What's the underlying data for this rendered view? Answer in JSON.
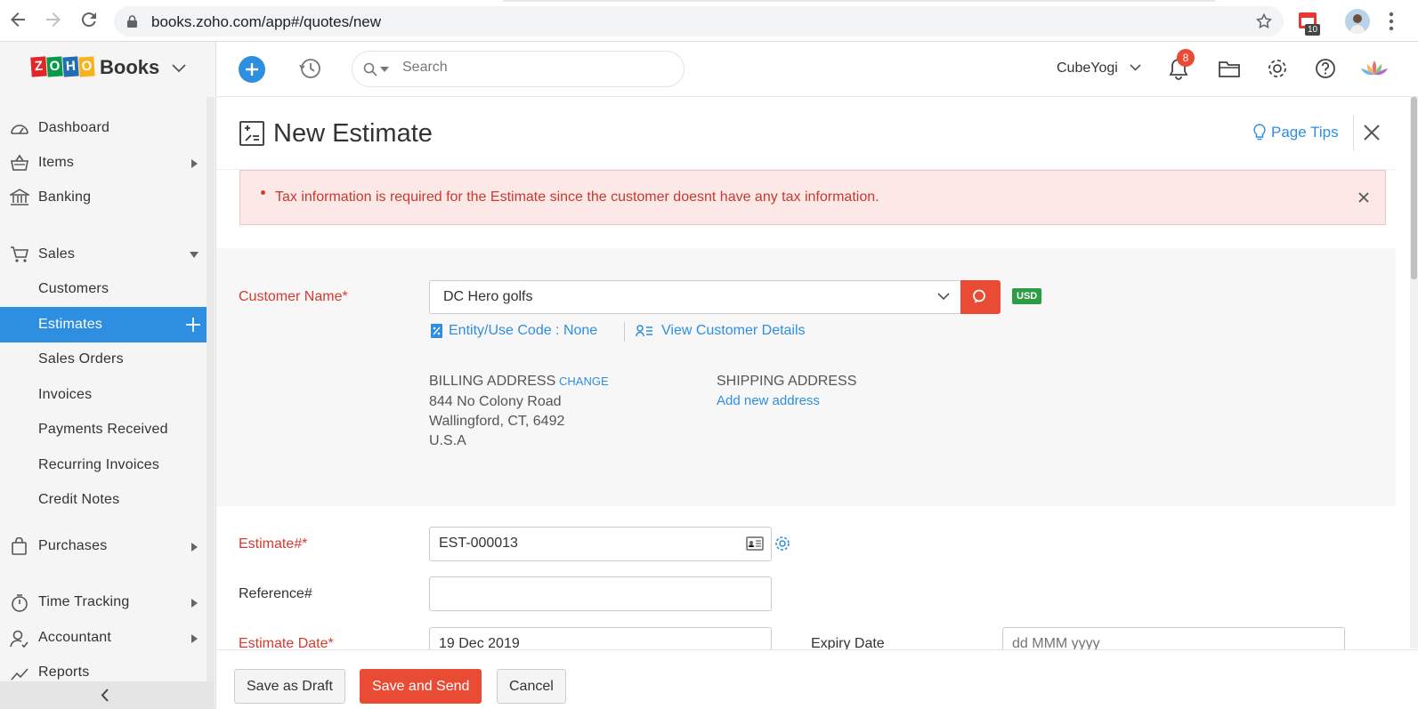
{
  "browser": {
    "url": "books.zoho.com/app#/quotes/new",
    "extension_badge": "10"
  },
  "header": {
    "logo_letters": [
      "Z",
      "O",
      "H",
      "O"
    ],
    "logo_colors": [
      "#e42527",
      "#089949",
      "#226db4",
      "#f9b21d"
    ],
    "product": "Books",
    "search_placeholder": "Search",
    "org_name": "CubeYogi",
    "notification_count": "8"
  },
  "sidebar": {
    "items": [
      {
        "label": "Dashboard",
        "icon": "dashboard-icon"
      },
      {
        "label": "Items",
        "icon": "basket-icon",
        "arrow": "right"
      },
      {
        "label": "Banking",
        "icon": "bank-icon"
      },
      {
        "label": "Sales",
        "icon": "cart-icon",
        "arrow": "down"
      },
      {
        "label": "Customers"
      },
      {
        "label": "Estimates",
        "active": true
      },
      {
        "label": "Sales Orders"
      },
      {
        "label": "Invoices"
      },
      {
        "label": "Payments Received"
      },
      {
        "label": "Recurring Invoices"
      },
      {
        "label": "Credit Notes"
      },
      {
        "label": "Purchases",
        "icon": "bag-icon",
        "arrow": "right"
      },
      {
        "label": "Time Tracking",
        "icon": "stopwatch-icon",
        "arrow": "right"
      },
      {
        "label": "Accountant",
        "icon": "accountant-icon",
        "arrow": "right"
      },
      {
        "label": "Reports",
        "icon": "reports-icon"
      }
    ]
  },
  "page": {
    "title": "New Estimate",
    "page_tips": "Page Tips",
    "alert": "Tax information is required for the Estimate since the customer doesnt have any tax information."
  },
  "customer": {
    "label": "Customer Name*",
    "value": "DC Hero golfs",
    "currency": "USD",
    "entity_link": "Entity/Use Code : None",
    "view_link": "View Customer Details",
    "billing_heading": "BILLING ADDRESS",
    "change_link": "CHANGE",
    "billing_lines": [
      "844 No Colony Road",
      "Wallingford, CT, 6492",
      "U.S.A"
    ],
    "shipping_heading": "SHIPPING ADDRESS",
    "add_address_link": "Add new address"
  },
  "form": {
    "estimate_label": "Estimate#*",
    "estimate_value": "EST-000013",
    "reference_label": "Reference#",
    "reference_value": "",
    "date_label": "Estimate Date*",
    "date_value": "19 Dec 2019",
    "expiry_label": "Expiry Date",
    "expiry_placeholder": "dd MMM yyyy"
  },
  "footer": {
    "save_draft": "Save as Draft",
    "save_send": "Save and Send",
    "cancel": "Cancel"
  },
  "colors": {
    "accent": "#2e8ee0",
    "danger": "#e94b35",
    "usd_badge": "#2e9c46"
  }
}
